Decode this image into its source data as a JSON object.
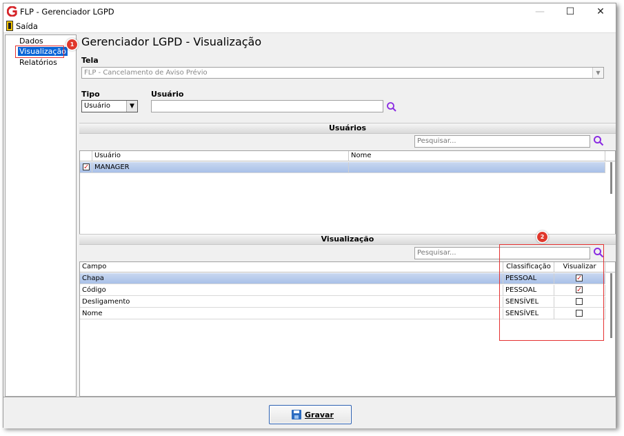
{
  "window": {
    "title": "FLP - Gerenciador LGPD",
    "minimize": "—",
    "maximize": "☐",
    "close": "✕"
  },
  "menu": {
    "exit_label": "Saída"
  },
  "sidebar": {
    "items": [
      {
        "label": "Dados"
      },
      {
        "label": "Visualização",
        "selected": true
      },
      {
        "label": "Relatórios"
      }
    ]
  },
  "annotations": {
    "badge1": "1",
    "badge2": "2",
    "color": "#e53030"
  },
  "page": {
    "title": "Gerenciador LGPD - Visualização",
    "tela_label": "Tela",
    "tela_value": "FLP - Cancelamento de Aviso Prévio",
    "tipo_label": "Tipo",
    "tipo_value": "Usuário",
    "usuario_label": "Usuário",
    "usuario_value": ""
  },
  "usuarios": {
    "header": "Usuários",
    "search_placeholder": "Pesquisar...",
    "columns": [
      "Usuário",
      "Nome"
    ],
    "rows": [
      {
        "checked": true,
        "usuario": "MANAGER",
        "nome": ""
      }
    ]
  },
  "visualizacao": {
    "header": "Visualização",
    "search_placeholder": "Pesquisar...",
    "columns": [
      "Campo",
      "Classificação",
      "Visualizar"
    ],
    "rows": [
      {
        "campo": "Chapa",
        "classificacao": "PESSOAL",
        "visualizar": true,
        "selected": true
      },
      {
        "campo": "Código",
        "classificacao": "PESSOAL",
        "visualizar": true
      },
      {
        "campo": "Desligamento",
        "classificacao": "SENSÍVEL",
        "visualizar": false
      },
      {
        "campo": "Nome",
        "classificacao": "SENSÍVEL",
        "visualizar": false
      }
    ]
  },
  "footer": {
    "save_label": "Gravar"
  },
  "colors": {
    "accent": "#0a64d6",
    "selection": "#a8c0e8",
    "search_icon": "#8a2be2"
  }
}
